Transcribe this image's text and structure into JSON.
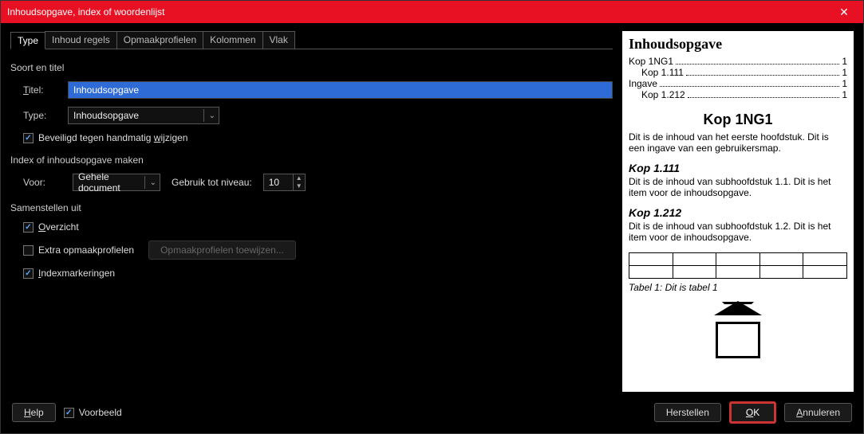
{
  "title": "Inhoudsopgave, index of woordenlijst",
  "tabs": [
    "Type",
    "Inhoud regels",
    "Opmaakprofielen",
    "Kolommen",
    "Vlak"
  ],
  "group1": "Soort en titel",
  "titel_label": "Titel:",
  "titel_value": "Inhoudsopgave",
  "type_label": "Type:",
  "type_value": "Inhoudsopgave",
  "protect_label": "Beveiligd tegen handmatig wijzigen",
  "group2": "Index of inhoudsopgave maken",
  "voor_label": "Voor:",
  "voor_value": "Gehele document",
  "level_label": "Gebruik tot niveau:",
  "level_value": "10",
  "group3": "Samenstellen uit",
  "overzicht": "Overzicht",
  "extra_styles": "Extra opmaakprofielen",
  "assign_styles_btn": "Opmaakprofielen toewijzen...",
  "index_marks": "Indexmarkeringen",
  "footer": {
    "help": "Help",
    "preview": "Voorbeeld",
    "reset": "Herstellen",
    "ok": "OK",
    "cancel": "Annuleren"
  },
  "preview": {
    "h1": "Inhoudsopgave",
    "toc": [
      {
        "t": "Kop 1NG1",
        "p": "1",
        "indent": 0
      },
      {
        "t": "Kop 1.111",
        "p": "1",
        "indent": 16
      },
      {
        "t": "Ingave",
        "p": "1",
        "indent": 0
      },
      {
        "t": "Kop 1.212",
        "p": "1",
        "indent": 16
      }
    ],
    "sec_h": "Kop 1NG1",
    "sec_p": "Dit is de inhoud van het eerste hoofdstuk. Dit is een ingave van een gebruikersmap.",
    "sub1_h": "Kop 1.111",
    "sub1_p": "Dit is de inhoud van subhoofdstuk 1.1. Dit is het item voor de inhoudsopgave.",
    "sub2_h": "Kop 1.212",
    "sub2_p": "Dit is de inhoud van subhoofdstuk 1.2. Dit is het item voor de inhoudsopgave.",
    "caption": "Tabel 1: Dit is tabel 1"
  }
}
